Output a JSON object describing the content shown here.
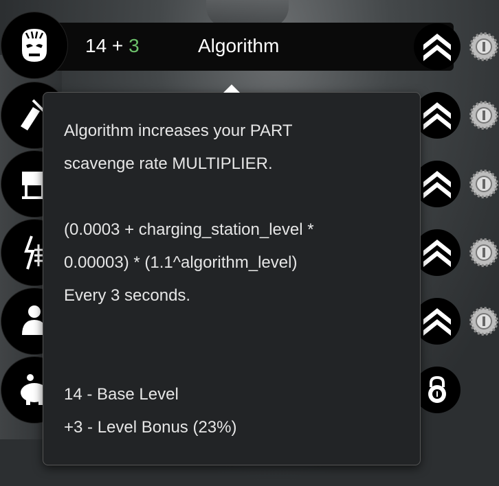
{
  "skill": {
    "base_level": "14",
    "plus": " + ",
    "bonus_level": "3",
    "name": "Algorithm"
  },
  "icons": {
    "rows": [
      "face-mask-icon",
      "writing-hand-icon",
      "robot-desk-icon",
      "lightning-antenna-icon",
      "meditating-person-icon",
      "piggy-bank-icon"
    ],
    "upgrade": "double-chevron-up-icon",
    "gear": "gear-icon",
    "lock": "padlock-icon"
  },
  "tooltip": {
    "lines": [
      "Algorithm increases your PART",
      "scavenge rate MULTIPLIER.",
      "(0.0003 + charging_station_level *",
      "0.00003) * (1.1^algorithm_level)",
      "Every 3 seconds.",
      "14 - Base Level",
      "+3 - Level Bonus (23%)"
    ]
  },
  "colors": {
    "bonus": "#6cbf6a",
    "tooltip_bg": "#222426",
    "text": "#e6e6e6"
  }
}
